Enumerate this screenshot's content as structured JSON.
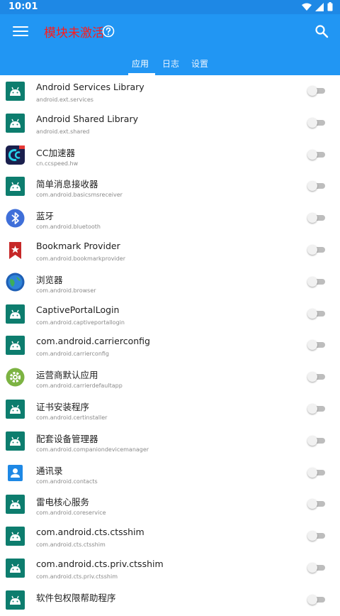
{
  "status_bar": {
    "time": "10:01",
    "icons": [
      "wifi-icon",
      "signal-icon",
      "battery-icon"
    ]
  },
  "app_bar": {
    "title": "模块未激活",
    "title_color": "#ff1a1a",
    "background": "#2196f3",
    "icons": [
      "menu-icon",
      "help-icon",
      "search-icon"
    ]
  },
  "tabs": [
    {
      "label": "应用",
      "active": true
    },
    {
      "label": "日志",
      "active": false
    },
    {
      "label": "设置",
      "active": false
    }
  ],
  "apps": [
    {
      "name": "Android Services Library",
      "package": "android.ext.services",
      "icon": "android-icon",
      "enabled": false
    },
    {
      "name": "Android Shared Library",
      "package": "android.ext.shared",
      "icon": "android-icon",
      "enabled": false
    },
    {
      "name": "CC加速器",
      "package": "cn.ccspeed.hw",
      "icon": "cc-accelerator-icon",
      "enabled": false
    },
    {
      "name": "简单消息接收器",
      "package": "com.android.basicsmsreceiver",
      "icon": "android-icon",
      "enabled": false
    },
    {
      "name": "蓝牙",
      "package": "com.android.bluetooth",
      "icon": "bluetooth-icon",
      "enabled": false
    },
    {
      "name": "Bookmark Provider",
      "package": "com.android.bookmarkprovider",
      "icon": "bookmark-icon",
      "enabled": false
    },
    {
      "name": "浏览器",
      "package": "com.android.browser",
      "icon": "browser-globe-icon",
      "enabled": false
    },
    {
      "name": "CaptivePortalLogin",
      "package": "com.android.captiveportallogin",
      "icon": "android-icon",
      "enabled": false
    },
    {
      "name": "com.android.carrierconfig",
      "package": "com.android.carrierconfig",
      "icon": "android-icon",
      "enabled": false
    },
    {
      "name": "运营商默认应用",
      "package": "com.android.carrierdefaultapp",
      "icon": "gear-icon",
      "enabled": false
    },
    {
      "name": "证书安装程序",
      "package": "com.android.certinstaller",
      "icon": "android-icon",
      "enabled": false
    },
    {
      "name": "配套设备管理器",
      "package": "com.android.companiondevicemanager",
      "icon": "android-icon",
      "enabled": false
    },
    {
      "name": "通讯录",
      "package": "com.android.contacts",
      "icon": "contacts-icon",
      "enabled": false
    },
    {
      "name": "雷电核心服务",
      "package": "com.android.coreservice",
      "icon": "android-icon",
      "enabled": false
    },
    {
      "name": "com.android.cts.ctsshim",
      "package": "com.android.cts.ctsshim",
      "icon": "android-icon",
      "enabled": false
    },
    {
      "name": "com.android.cts.priv.ctsshim",
      "package": "com.android.cts.priv.ctsshim",
      "icon": "android-icon",
      "enabled": false
    },
    {
      "name": "软件包权限帮助程序",
      "package": "",
      "icon": "android-icon",
      "enabled": false
    }
  ]
}
